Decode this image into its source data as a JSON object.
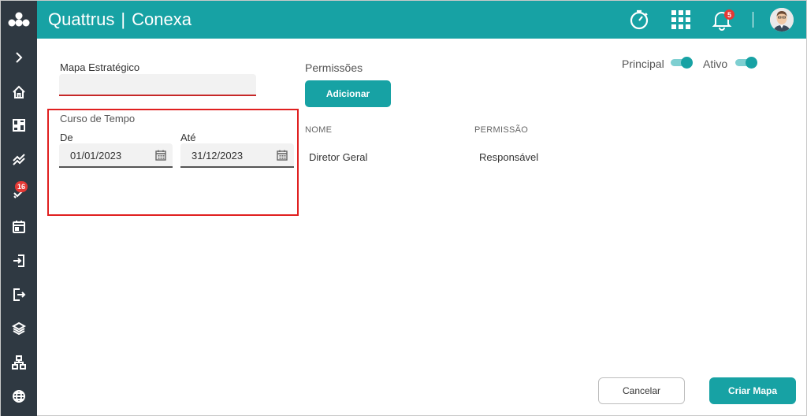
{
  "app": {
    "brand_name": "Quattrus",
    "brand_separator": "|",
    "brand_product": "Conexa"
  },
  "header": {
    "notifications_count": "5"
  },
  "sidebar": {
    "items": [
      {
        "icon": "chevron-right-icon"
      },
      {
        "icon": "home-icon"
      },
      {
        "icon": "dashboard-icon"
      },
      {
        "icon": "trend-icon"
      },
      {
        "icon": "tasks-icon",
        "badge": "16"
      },
      {
        "icon": "calendar-icon"
      },
      {
        "icon": "login-icon"
      },
      {
        "icon": "logout-icon"
      },
      {
        "icon": "layers-icon"
      },
      {
        "icon": "hierarchy-icon"
      },
      {
        "icon": "globe-icon"
      }
    ]
  },
  "form": {
    "mapa_label": "Mapa Estratégico",
    "mapa_value": "",
    "curso_label": "Curso de Tempo",
    "de_label": "De",
    "de_value": "01/01/2023",
    "ate_label": "Até",
    "ate_value": "31/12/2023"
  },
  "permissions": {
    "title": "Permissões",
    "add_label": "Adicionar",
    "columns": [
      "NOME",
      "PERMISSÃO"
    ],
    "rows": [
      {
        "nome": "Diretor Geral",
        "permissao": "Responsável"
      }
    ]
  },
  "toggles": {
    "principal_label": "Principal",
    "principal_on": true,
    "ativo_label": "Ativo",
    "ativo_on": true
  },
  "footer": {
    "cancel_label": "Cancelar",
    "create_label": "Criar Mapa"
  },
  "colors": {
    "accent": "#17a2a4",
    "sidebar": "#2f3942",
    "error": "#c62828",
    "highlight": "#e02020"
  }
}
